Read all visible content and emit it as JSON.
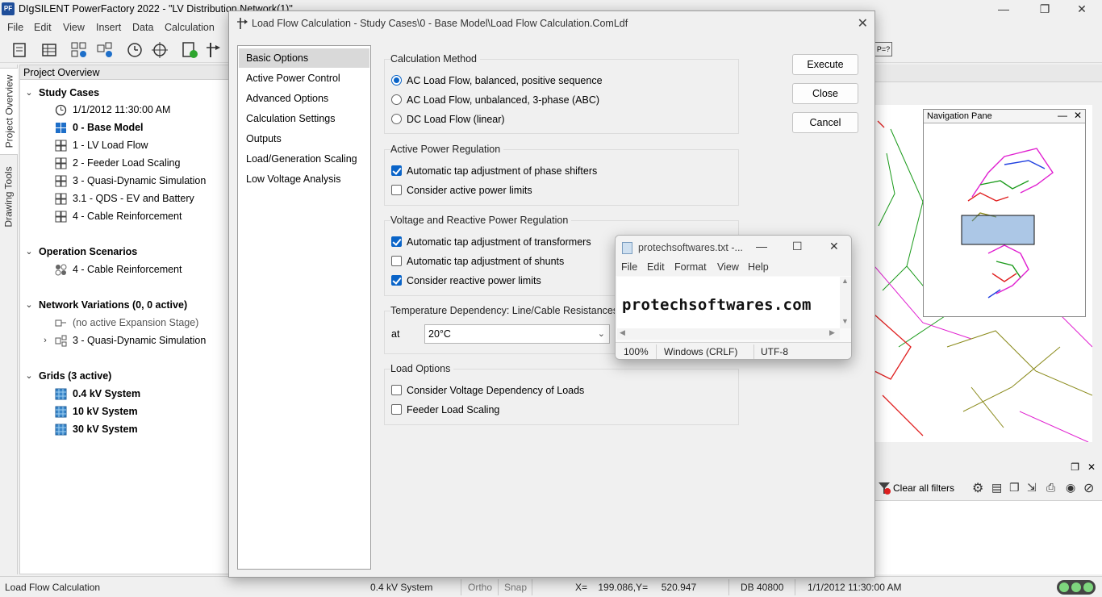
{
  "app": {
    "logo": "PF",
    "title": "DIgSILENT PowerFactory 2022  - \"LV Distribution Network(1)\"",
    "menu": [
      "File",
      "Edit",
      "View",
      "Insert",
      "Data",
      "Calculation"
    ]
  },
  "side_tabs": [
    "Project Overview",
    "Drawing Tools"
  ],
  "project_overview": {
    "header": "Project Overview",
    "study_cases": {
      "label": "Study Cases",
      "items": [
        "1/1/2012 11:30:00 AM",
        "0 - Base Model",
        "1 - LV Load Flow",
        "2 - Feeder Load Scaling",
        "3 - Quasi-Dynamic Simulation",
        "3.1 - QDS - EV and Battery",
        "4 - Cable Reinforcement"
      ]
    },
    "operation_scenarios": {
      "label": "Operation Scenarios",
      "items": [
        "4 - Cable Reinforcement"
      ]
    },
    "network_variations": {
      "label": "Network Variations (0, 0 active)",
      "items": [
        "(no active Expansion Stage)",
        "3 - Quasi-Dynamic Simulation"
      ]
    },
    "grids": {
      "label": "Grids (3 active)",
      "items": [
        "0.4 kV System",
        "10 kV System",
        "30 kV System"
      ]
    }
  },
  "dialog": {
    "title": "Load Flow Calculation - Study Cases\\0 - Base Model\\Load Flow Calculation.ComLdf",
    "pages": [
      "Basic Options",
      "Active Power Control",
      "Advanced Options",
      "Calculation Settings",
      "Outputs",
      "Load/Generation Scaling",
      "Low Voltage Analysis"
    ],
    "selected_page": "Basic Options",
    "calc_method": {
      "title": "Calculation Method",
      "options": [
        "AC Load Flow, balanced, positive sequence",
        "AC Load Flow, unbalanced, 3-phase (ABC)",
        "DC Load Flow (linear)"
      ],
      "selected": "AC Load Flow, balanced, positive sequence"
    },
    "active_power": {
      "title": "Active Power Regulation",
      "options": [
        {
          "label": "Automatic tap adjustment of phase shifters",
          "checked": true
        },
        {
          "label": "Consider active power limits",
          "checked": false
        }
      ]
    },
    "voltage_reactive": {
      "title": "Voltage and Reactive Power Regulation",
      "options": [
        {
          "label": "Automatic tap adjustment of transformers",
          "checked": true
        },
        {
          "label": "Automatic tap adjustment of shunts",
          "checked": false
        },
        {
          "label": "Consider reactive power limits",
          "checked": true
        }
      ]
    },
    "temperature": {
      "title": "Temperature Dependency: Line/Cable Resistances",
      "at_label": "at",
      "value": "20°C"
    },
    "load_options": {
      "title": "Load Options",
      "options": [
        {
          "label": "Consider Voltage Dependency of Loads",
          "checked": false
        },
        {
          "label": "Feeder Load Scaling",
          "checked": false
        }
      ]
    },
    "buttons": {
      "execute": "Execute",
      "close": "Close",
      "cancel": "Cancel"
    }
  },
  "notepad": {
    "title": "protechsoftwares.txt -...",
    "menu": [
      "File",
      "Edit",
      "Format",
      "View",
      "Help"
    ],
    "content": "protechsoftwares.com",
    "status": {
      "zoom": "100%",
      "eol": "Windows (CRLF)",
      "encoding": "UTF-8"
    }
  },
  "nav_pane": {
    "title": "Navigation Pane"
  },
  "filters": {
    "clear_label": "Clear all filters"
  },
  "toolbar_right": {
    "label": "P=?"
  },
  "statusbar": {
    "left": "Load Flow Calculation",
    "grid": "0.4 kV System",
    "ortho": "Ortho",
    "snap": "Snap",
    "coords": "X=    199.086,Y=     520.947",
    "db": "DB 40800",
    "time": "1/1/2012 11:30:00 AM"
  },
  "colors": {
    "accent": "#0a64c8",
    "network_green": "#1a9a1a",
    "network_magenta": "#e020d0",
    "network_red": "#e02020",
    "network_olive": "#8a8a1a"
  }
}
